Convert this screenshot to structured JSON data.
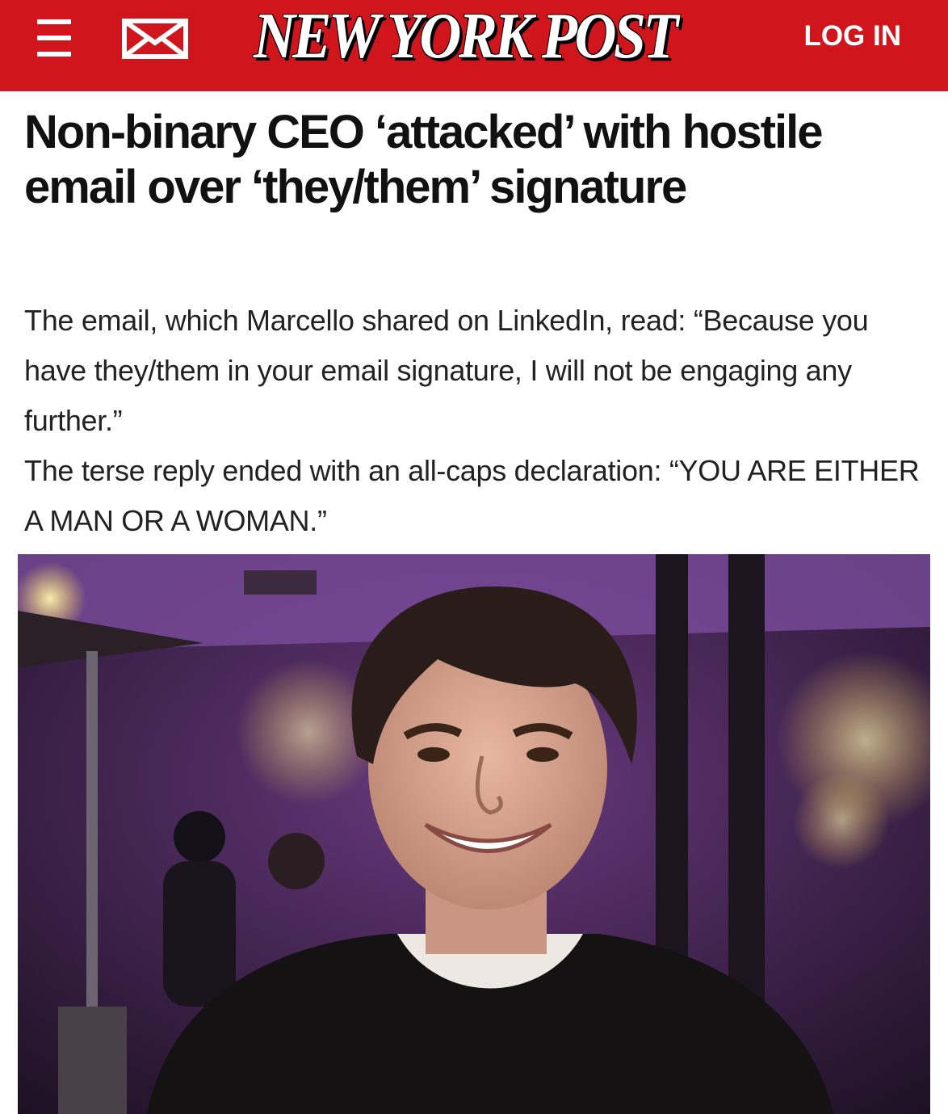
{
  "header": {
    "logo_text": "NEW YORK POST",
    "login_label": "LOG IN",
    "menu_icon": "hamburger-menu-icon",
    "mail_icon": "envelope-icon",
    "brand_color": "#d0161c"
  },
  "article": {
    "headline": "Non-binary CEO ‘attacked’ with hostile email over ‘they/them’ signature",
    "paragraphs": [
      "The email, which Marcello shared on LinkedIn, read: “Because you have they/them in your email signature, I will not be engaging any further.”",
      "The terse reply ended with an all-caps declaration: “YOU ARE EITHER A MAN OR A WOMAN.”"
    ]
  },
  "photo": {
    "subject": "smiling person with short dark curly hair in a purple-lit restaurant"
  }
}
